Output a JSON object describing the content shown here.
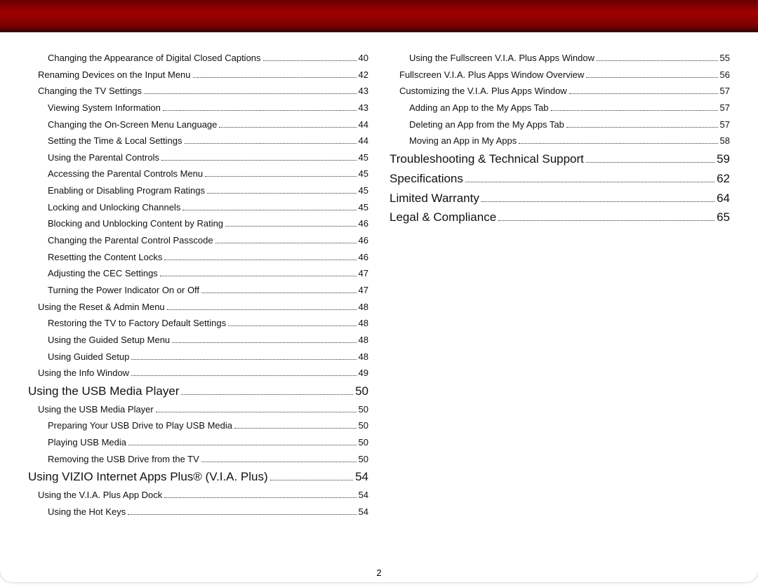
{
  "page_number": "2",
  "toc": {
    "leftColumn": [
      {
        "level": "ind2",
        "title": "Changing the Appearance of Digital Closed Captions",
        "page": "40"
      },
      {
        "level": "ind1",
        "title": "Renaming Devices on the Input Menu",
        "page": "42"
      },
      {
        "level": "ind1",
        "title": "Changing the TV Settings",
        "page": "43"
      },
      {
        "level": "ind2",
        "title": "Viewing System Information",
        "page": "43"
      },
      {
        "level": "ind2",
        "title": "Changing the On-Screen Menu Language",
        "page": "44"
      },
      {
        "level": "ind2",
        "title": "Setting the Time & Local Settings",
        "page": "44"
      },
      {
        "level": "ind2",
        "title": "Using the Parental Controls",
        "page": "45"
      },
      {
        "level": "ind2",
        "title": "Accessing the Parental Controls Menu",
        "page": "45"
      },
      {
        "level": "ind2",
        "title": "Enabling or Disabling Program Ratings",
        "page": "45"
      },
      {
        "level": "ind2",
        "title": "Locking and Unlocking Channels",
        "page": "45"
      },
      {
        "level": "ind2",
        "title": "Blocking and Unblocking Content by Rating",
        "page": "46"
      },
      {
        "level": "ind2",
        "title": "Changing the Parental Control Passcode",
        "page": "46"
      },
      {
        "level": "ind2",
        "title": "Resetting the Content Locks",
        "page": "46"
      },
      {
        "level": "ind2",
        "title": "Adjusting the CEC Settings",
        "page": "47"
      },
      {
        "level": "ind2",
        "title": "Turning the Power Indicator On or Off",
        "page": "47"
      },
      {
        "level": "ind1",
        "title": "Using the Reset & Admin Menu",
        "page": "48"
      },
      {
        "level": "ind2",
        "title": "Restoring the TV to Factory Default Settings",
        "page": "48"
      },
      {
        "level": "ind2",
        "title": "Using the Guided Setup Menu",
        "page": "48"
      },
      {
        "level": "ind2",
        "title": "Using Guided Setup",
        "page": "48"
      },
      {
        "level": "ind1",
        "title": "Using the Info Window",
        "page": "49"
      },
      {
        "level": "section",
        "title": "Using the USB Media Player",
        "page": "50"
      },
      {
        "level": "ind1",
        "title": "Using the USB Media Player",
        "page": "50"
      },
      {
        "level": "ind2",
        "title": "Preparing Your USB Drive to Play USB Media",
        "page": "50"
      },
      {
        "level": "ind2",
        "title": "Playing USB Media",
        "page": "50"
      },
      {
        "level": "ind2",
        "title": "Removing the USB Drive from the TV",
        "page": "50"
      },
      {
        "level": "section",
        "title": "Using VIZIO Internet Apps Plus® (V.I.A. Plus)",
        "page": "54"
      },
      {
        "level": "ind1",
        "title": "Using the V.I.A. Plus App Dock",
        "page": "54"
      },
      {
        "level": "ind2",
        "title": "Using the Hot Keys",
        "page": "54"
      }
    ],
    "rightColumn": [
      {
        "level": "ind2",
        "title": "Using the Fullscreen V.I.A. Plus Apps Window",
        "page": "55"
      },
      {
        "level": "ind1",
        "title": "Fullscreen V.I.A. Plus Apps Window Overview",
        "page": "56"
      },
      {
        "level": "ind1",
        "title": "Customizing the V.I.A. Plus Apps Window",
        "page": "57"
      },
      {
        "level": "ind2",
        "title": "Adding an App to the My Apps Tab",
        "page": "57"
      },
      {
        "level": "ind2",
        "title": "Deleting an App from the My Apps Tab",
        "page": "57"
      },
      {
        "level": "ind2",
        "title": "Moving an App in My Apps",
        "page": "58"
      },
      {
        "level": "section",
        "title": "Troubleshooting & Technical Support",
        "page": "59"
      },
      {
        "level": "section",
        "title": "Specifications",
        "page": "62"
      },
      {
        "level": "section",
        "title": "Limited Warranty",
        "page": "64"
      },
      {
        "level": "section",
        "title": "Legal & Compliance",
        "page": "65"
      }
    ]
  }
}
